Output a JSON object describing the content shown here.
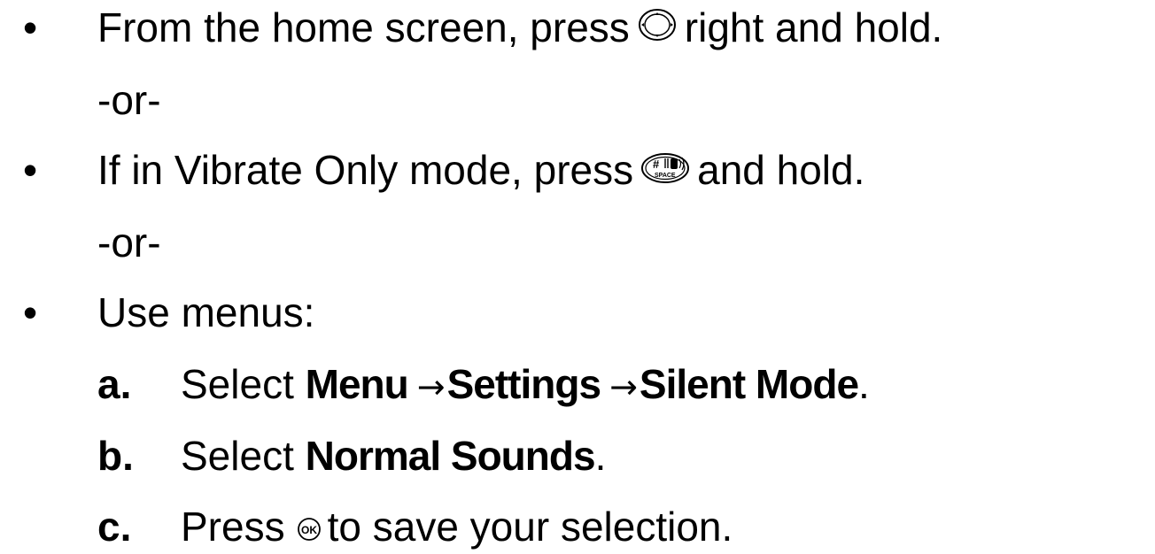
{
  "bullets": [
    "•",
    "•",
    "•"
  ],
  "item1": {
    "before": "From the home screen, press",
    "key_icon": "navigation-key-icon",
    "after": "right and hold."
  },
  "or_text": "-or-",
  "item2": {
    "before": "If in Vibrate Only mode, press",
    "key_icon": "pound-space-key-icon",
    "key_glyph": "#",
    "key_sublabel": "SPACE",
    "after": "and hold."
  },
  "item3": {
    "text": "Use menus:"
  },
  "steps": {
    "a": {
      "letter": "a.",
      "select": "Select",
      "menu": "Menu",
      "arrow": "→",
      "settings": "Settings",
      "silent": "Silent Mode",
      "period": "."
    },
    "b": {
      "letter": "b.",
      "select": "Select",
      "normal": "Normal Sounds",
      "period": "."
    },
    "c": {
      "letter": "c.",
      "press": "Press",
      "key_icon": "ok-key-icon",
      "key_label": "OK",
      "after": "to save your selection."
    }
  }
}
